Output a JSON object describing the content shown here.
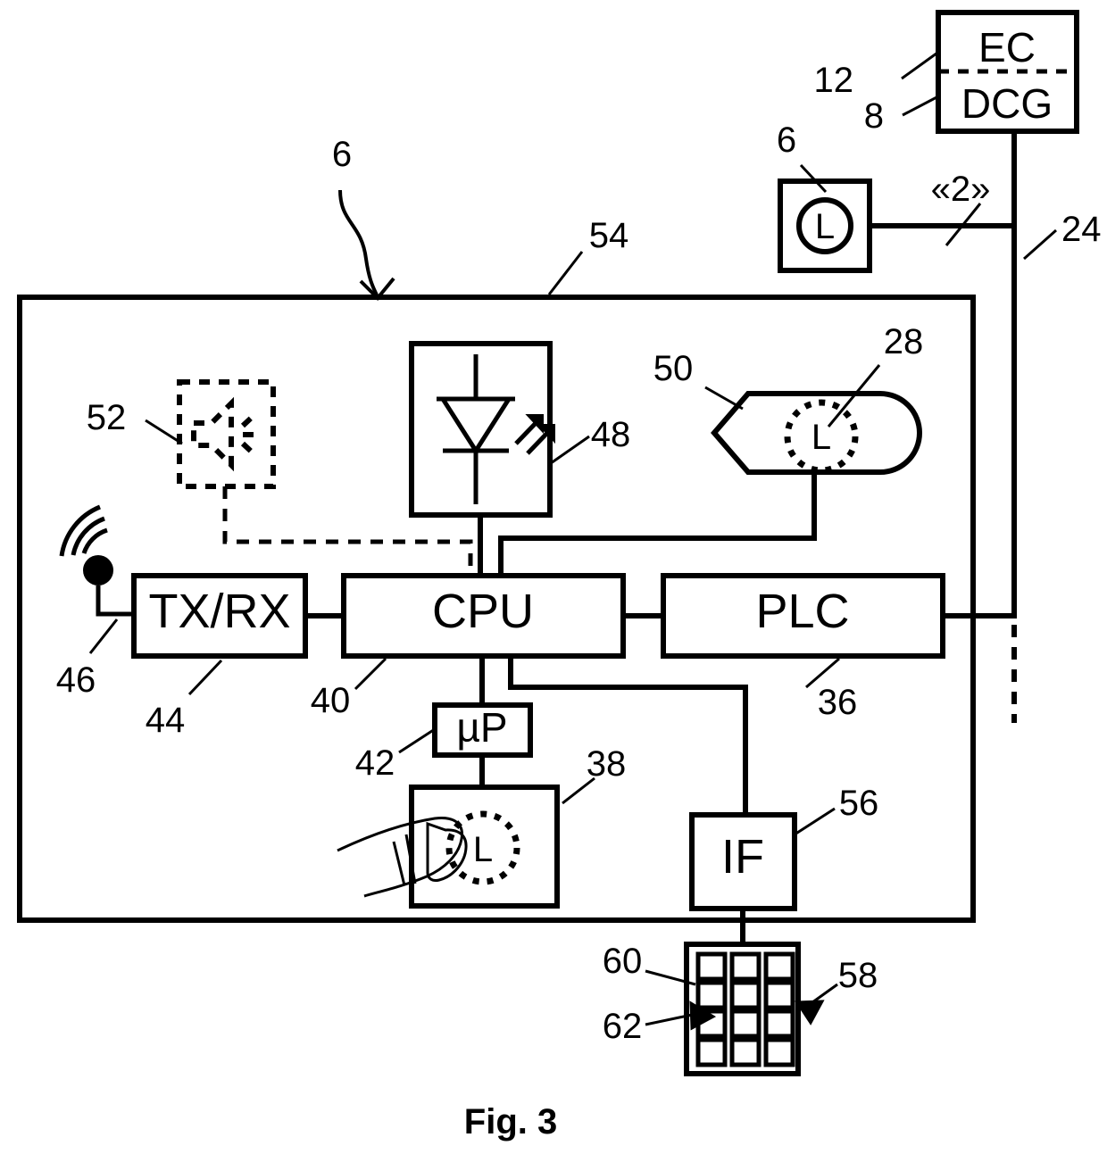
{
  "figure": {
    "caption": "Fig. 3",
    "type": "patent-block-diagram"
  },
  "blocks": {
    "ec_dcg": {
      "line1": "EC",
      "line2": "DCG",
      "ref_top": "12",
      "ref_bottom": "8"
    },
    "external_luminaire": {
      "label": "L",
      "ref": "6",
      "link_label": "«2»"
    },
    "bus": {
      "ref": "24"
    },
    "enclosure": {
      "ref": "54",
      "pointer_ref": "6"
    },
    "speaker": {
      "ref": "52",
      "icon": "loudspeaker-icon"
    },
    "led": {
      "ref": "48",
      "icon": "led-diode-icon"
    },
    "sensor_50": {
      "ref": "50",
      "label": "L",
      "inner_ref": "28",
      "icon": "lamp-sensor-icon"
    },
    "txrx": {
      "label": "TX/RX",
      "ref": "44"
    },
    "antenna": {
      "ref": "46",
      "icon": "antenna-icon"
    },
    "cpu": {
      "label": "CPU",
      "ref": "40"
    },
    "plc": {
      "label": "PLC",
      "ref": "36"
    },
    "micro": {
      "label": "µP",
      "ref": "42"
    },
    "touch_38": {
      "ref": "38",
      "label": "L",
      "icon": "fingerprint-touch-icon"
    },
    "interface": {
      "label": "IF",
      "ref": "56"
    },
    "keypad": {
      "ref": "58",
      "key_ref": "60",
      "pointer_ref": "62",
      "rows": 4,
      "cols": 3
    }
  }
}
